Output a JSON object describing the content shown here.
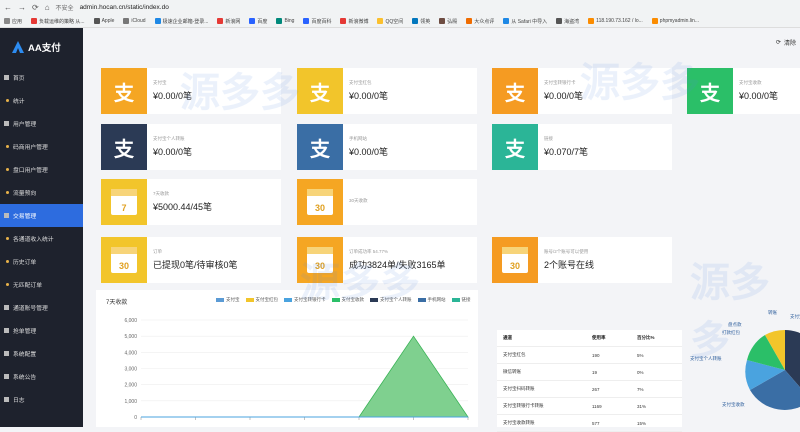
{
  "browser": {
    "url": "admin.hocan.cn/static/index.do",
    "secure_label": "不安全",
    "bookmarks": [
      {
        "label": "应用",
        "color": "#888"
      },
      {
        "label": "负载运维的策略 从...",
        "color": "#e53935"
      },
      {
        "label": "Apple",
        "color": "#555"
      },
      {
        "label": "iCloud",
        "color": "#777"
      },
      {
        "label": "极速企业邮箱-登录...",
        "color": "#1e88e5"
      },
      {
        "label": "新浪网",
        "color": "#e53935"
      },
      {
        "label": "百度",
        "color": "#2962ff"
      },
      {
        "label": "Bing",
        "color": "#00897b"
      },
      {
        "label": "百度百科",
        "color": "#2962ff"
      },
      {
        "label": "新浪微博",
        "color": "#e53935"
      },
      {
        "label": "QQ空间",
        "color": "#fbc02d"
      },
      {
        "label": "领英",
        "color": "#0277bd"
      },
      {
        "label": "弘殿",
        "color": "#6d4c41"
      },
      {
        "label": "大众点评",
        "color": "#ef6c00"
      },
      {
        "label": "从 Safari 中导入",
        "color": "#1e88e5"
      },
      {
        "label": "海盗湾",
        "color": "#555"
      },
      {
        "label": "118.190.73.162 / lo...",
        "color": "#fb8c00"
      },
      {
        "label": "phpmyadmin.lin...",
        "color": "#fb8c00"
      }
    ]
  },
  "sidebar": {
    "logo": "AA支付",
    "items": [
      {
        "label": "首页",
        "sub": false,
        "active": false
      },
      {
        "label": "统计",
        "sub": true,
        "active": false
      },
      {
        "label": "用户管理",
        "sub": false,
        "active": false
      },
      {
        "label": "码商用户管理",
        "sub": true,
        "active": false
      },
      {
        "label": "盘口用户管理",
        "sub": true,
        "active": false
      },
      {
        "label": "流量预向",
        "sub": true,
        "active": false
      },
      {
        "label": "交易管理",
        "sub": false,
        "active": true
      },
      {
        "label": "各通道收入统计",
        "sub": true,
        "active": false
      },
      {
        "label": "历史订单",
        "sub": true,
        "active": false
      },
      {
        "label": "无匹配订单",
        "sub": true,
        "active": false
      },
      {
        "label": "通道账号管理",
        "sub": false,
        "active": false
      },
      {
        "label": "抢单管理",
        "sub": false,
        "active": false
      },
      {
        "label": "系统配置",
        "sub": false,
        "active": false
      },
      {
        "label": "系统公告",
        "sub": false,
        "active": false
      },
      {
        "label": "日志",
        "sub": false,
        "active": false
      }
    ]
  },
  "topbar": {
    "clear_label": "清除"
  },
  "cards": [
    {
      "label": "支付宝",
      "value": "¥0.00/0笔",
      "color": "#f5a623",
      "icon": "alipay-icon"
    },
    {
      "label": "支付宝红包",
      "value": "¥0.00/0笔",
      "color": "#f2c52b",
      "icon": "alipay-icon"
    },
    {
      "label": "支付宝转银行卡",
      "value": "¥0.00/0笔",
      "color": "#f59b22",
      "icon": "alipay-icon"
    },
    {
      "label": "支付宝收款",
      "value": "¥0.00/0笔",
      "color": "#2bbf68",
      "icon": "alipay-icon"
    },
    {
      "label": "支付宝个人转账",
      "value": "¥0.00/0笔",
      "color": "#2b3a55",
      "icon": "alipay-icon"
    },
    {
      "label": "手机网站",
      "value": "¥0.00/0笔",
      "color": "#3a6ea5",
      "icon": "alipay-icon"
    },
    {
      "label": "链接",
      "value": "¥0.070/7笔",
      "color": "#2bb597",
      "icon": "alipay-icon"
    },
    {
      "label": "7天收款",
      "value": "¥5000.44/45笔",
      "color": "#f2c52b",
      "icon": "calendar-icon",
      "cal": "7"
    },
    {
      "label": "30天收款",
      "value": "",
      "color": "#f5a623",
      "icon": "calendar-icon",
      "cal": "30"
    },
    {
      "label": "订单",
      "value": "已提现0笔/待审核0笔",
      "color": "#f2c52b",
      "icon": "calendar-icon",
      "cal": "30"
    },
    {
      "label": "订单成功率 54.77%",
      "value": "成功3824单/失败3165单",
      "color": "#f5a623",
      "icon": "calendar-icon",
      "cal": "30"
    },
    {
      "label": "账号/2个账号可以使用",
      "value": "2个账号在线",
      "color": "#f59b22",
      "icon": "calendar-icon",
      "cal": "30"
    }
  ],
  "chart_data": {
    "type": "area",
    "title": "7天收款",
    "series": [
      {
        "name": "支付宝",
        "color": "#5b9bd5"
      },
      {
        "name": "支付宝红包",
        "color": "#f2c52b"
      },
      {
        "name": "支付宝转银行卡",
        "color": "#4aa3df"
      },
      {
        "name": "支付宝收款",
        "color": "#2bbf68"
      },
      {
        "name": "支付宝个人转账",
        "color": "#2b3a55"
      },
      {
        "name": "手机网站",
        "color": "#3a6ea5"
      },
      {
        "name": "链接",
        "color": "#2bb597"
      }
    ],
    "yticks": [
      "0",
      "1,000",
      "2,000",
      "3,000",
      "4,000",
      "5,000",
      "6,000"
    ],
    "ylim": [
      0,
      6000
    ],
    "x_count": 7,
    "highlight_series": "链接",
    "highlight_values": [
      0,
      0,
      0,
      0,
      0,
      5000,
      0
    ]
  },
  "table": {
    "headers": [
      "通道",
      "使用率",
      "百分比%"
    ],
    "rows": [
      [
        "支付宝红包",
        "190",
        "5%"
      ],
      [
        "微信转账",
        "19",
        "0%"
      ],
      [
        "支付宝扫码转账",
        "267",
        "7%"
      ],
      [
        "支付宝转银行卡转账",
        "1169",
        "31%"
      ],
      [
        "支付宝收款转账",
        "577",
        "15%"
      ]
    ]
  },
  "pie": {
    "labels": [
      "转账",
      "支付宝",
      "盘点款",
      "打款红包",
      "支付宝个人转账",
      "支付宝收款"
    ]
  },
  "watermark": "源多多"
}
